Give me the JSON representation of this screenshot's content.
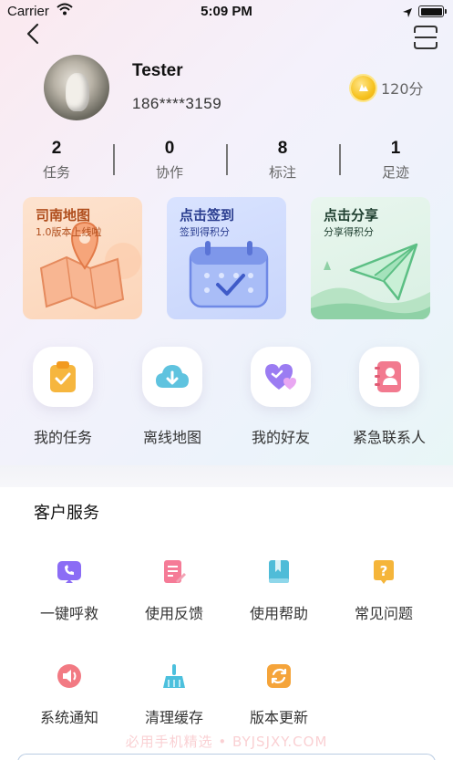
{
  "status_bar": {
    "carrier": "Carrier",
    "time": "5:09 PM"
  },
  "profile": {
    "name": "Tester",
    "phone": "186****3159",
    "points": "120分"
  },
  "stats": [
    {
      "value": "2",
      "label": "任务"
    },
    {
      "value": "0",
      "label": "协作"
    },
    {
      "value": "8",
      "label": "标注"
    },
    {
      "value": "1",
      "label": "足迹"
    }
  ],
  "cards": {
    "map": {
      "title": "司南地图",
      "subtitle": "1.0版本上线啦"
    },
    "sign": {
      "title": "点击签到",
      "subtitle": "签到得积分"
    },
    "share": {
      "title": "点击分享",
      "subtitle": "分享得积分"
    }
  },
  "quick": [
    {
      "label": "我的任务",
      "icon": "clipboard-icon"
    },
    {
      "label": "离线地图",
      "icon": "cloud-download-icon"
    },
    {
      "label": "我的好友",
      "icon": "heart-icon"
    },
    {
      "label": "紧急联系人",
      "icon": "contact-book-icon"
    }
  ],
  "service": {
    "title": "客户服务",
    "items": [
      {
        "label": "一键呼救",
        "icon": "phone-icon",
        "color": "#8b6cf5"
      },
      {
        "label": "使用反馈",
        "icon": "feedback-icon",
        "color": "#f57b97"
      },
      {
        "label": "使用帮助",
        "icon": "book-icon",
        "color": "#4fbcd8"
      },
      {
        "label": "常见问题",
        "icon": "question-icon",
        "color": "#f5b53a"
      },
      {
        "label": "系统通知",
        "icon": "speaker-icon",
        "color": "#f27a83"
      },
      {
        "label": "清理缓存",
        "icon": "broom-icon",
        "color": "#4cc0dd"
      },
      {
        "label": "版本更新",
        "icon": "refresh-icon",
        "color": "#f5a43a"
      }
    ]
  },
  "watermark": "必用手机精选 • BYJSJXY.COM"
}
